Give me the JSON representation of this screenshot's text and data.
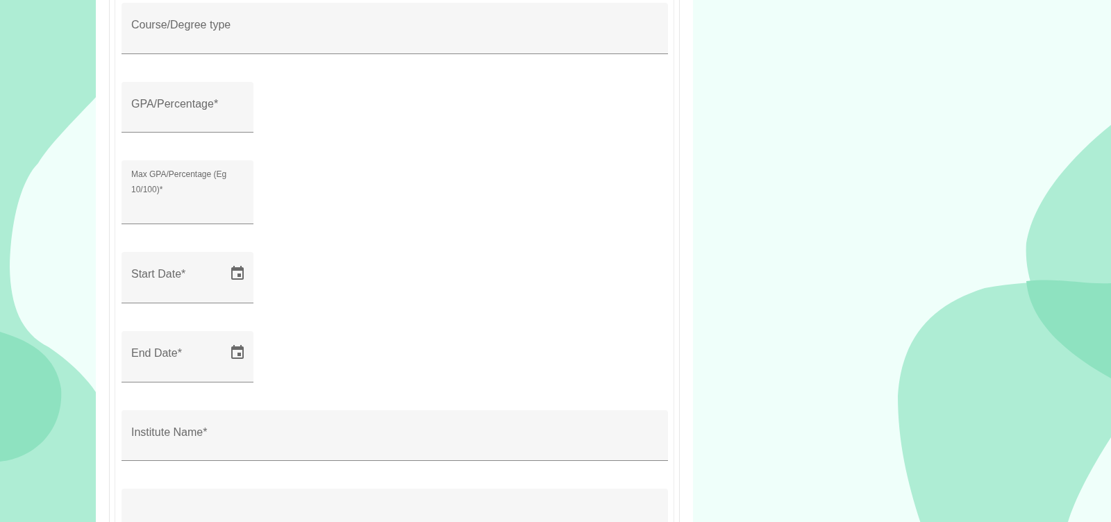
{
  "form": {
    "fields": [
      {
        "label": "Course/Degree type",
        "kind": "text",
        "wide": true,
        "compact": false
      },
      {
        "label": "GPA/Percentage*",
        "kind": "text",
        "wide": false,
        "compact": false
      },
      {
        "label": "Max GPA/Percentage (Eg 10/100)*",
        "kind": "text",
        "wide": false,
        "compact": true
      },
      {
        "label": "Start Date*",
        "kind": "date",
        "wide": false,
        "compact": false
      },
      {
        "label": "End Date*",
        "kind": "date",
        "wide": false,
        "compact": false
      },
      {
        "label": "Institute Name*",
        "kind": "text",
        "wide": true,
        "compact": false
      },
      {
        "kind": "text",
        "wide": true,
        "compact": false
      }
    ]
  }
}
